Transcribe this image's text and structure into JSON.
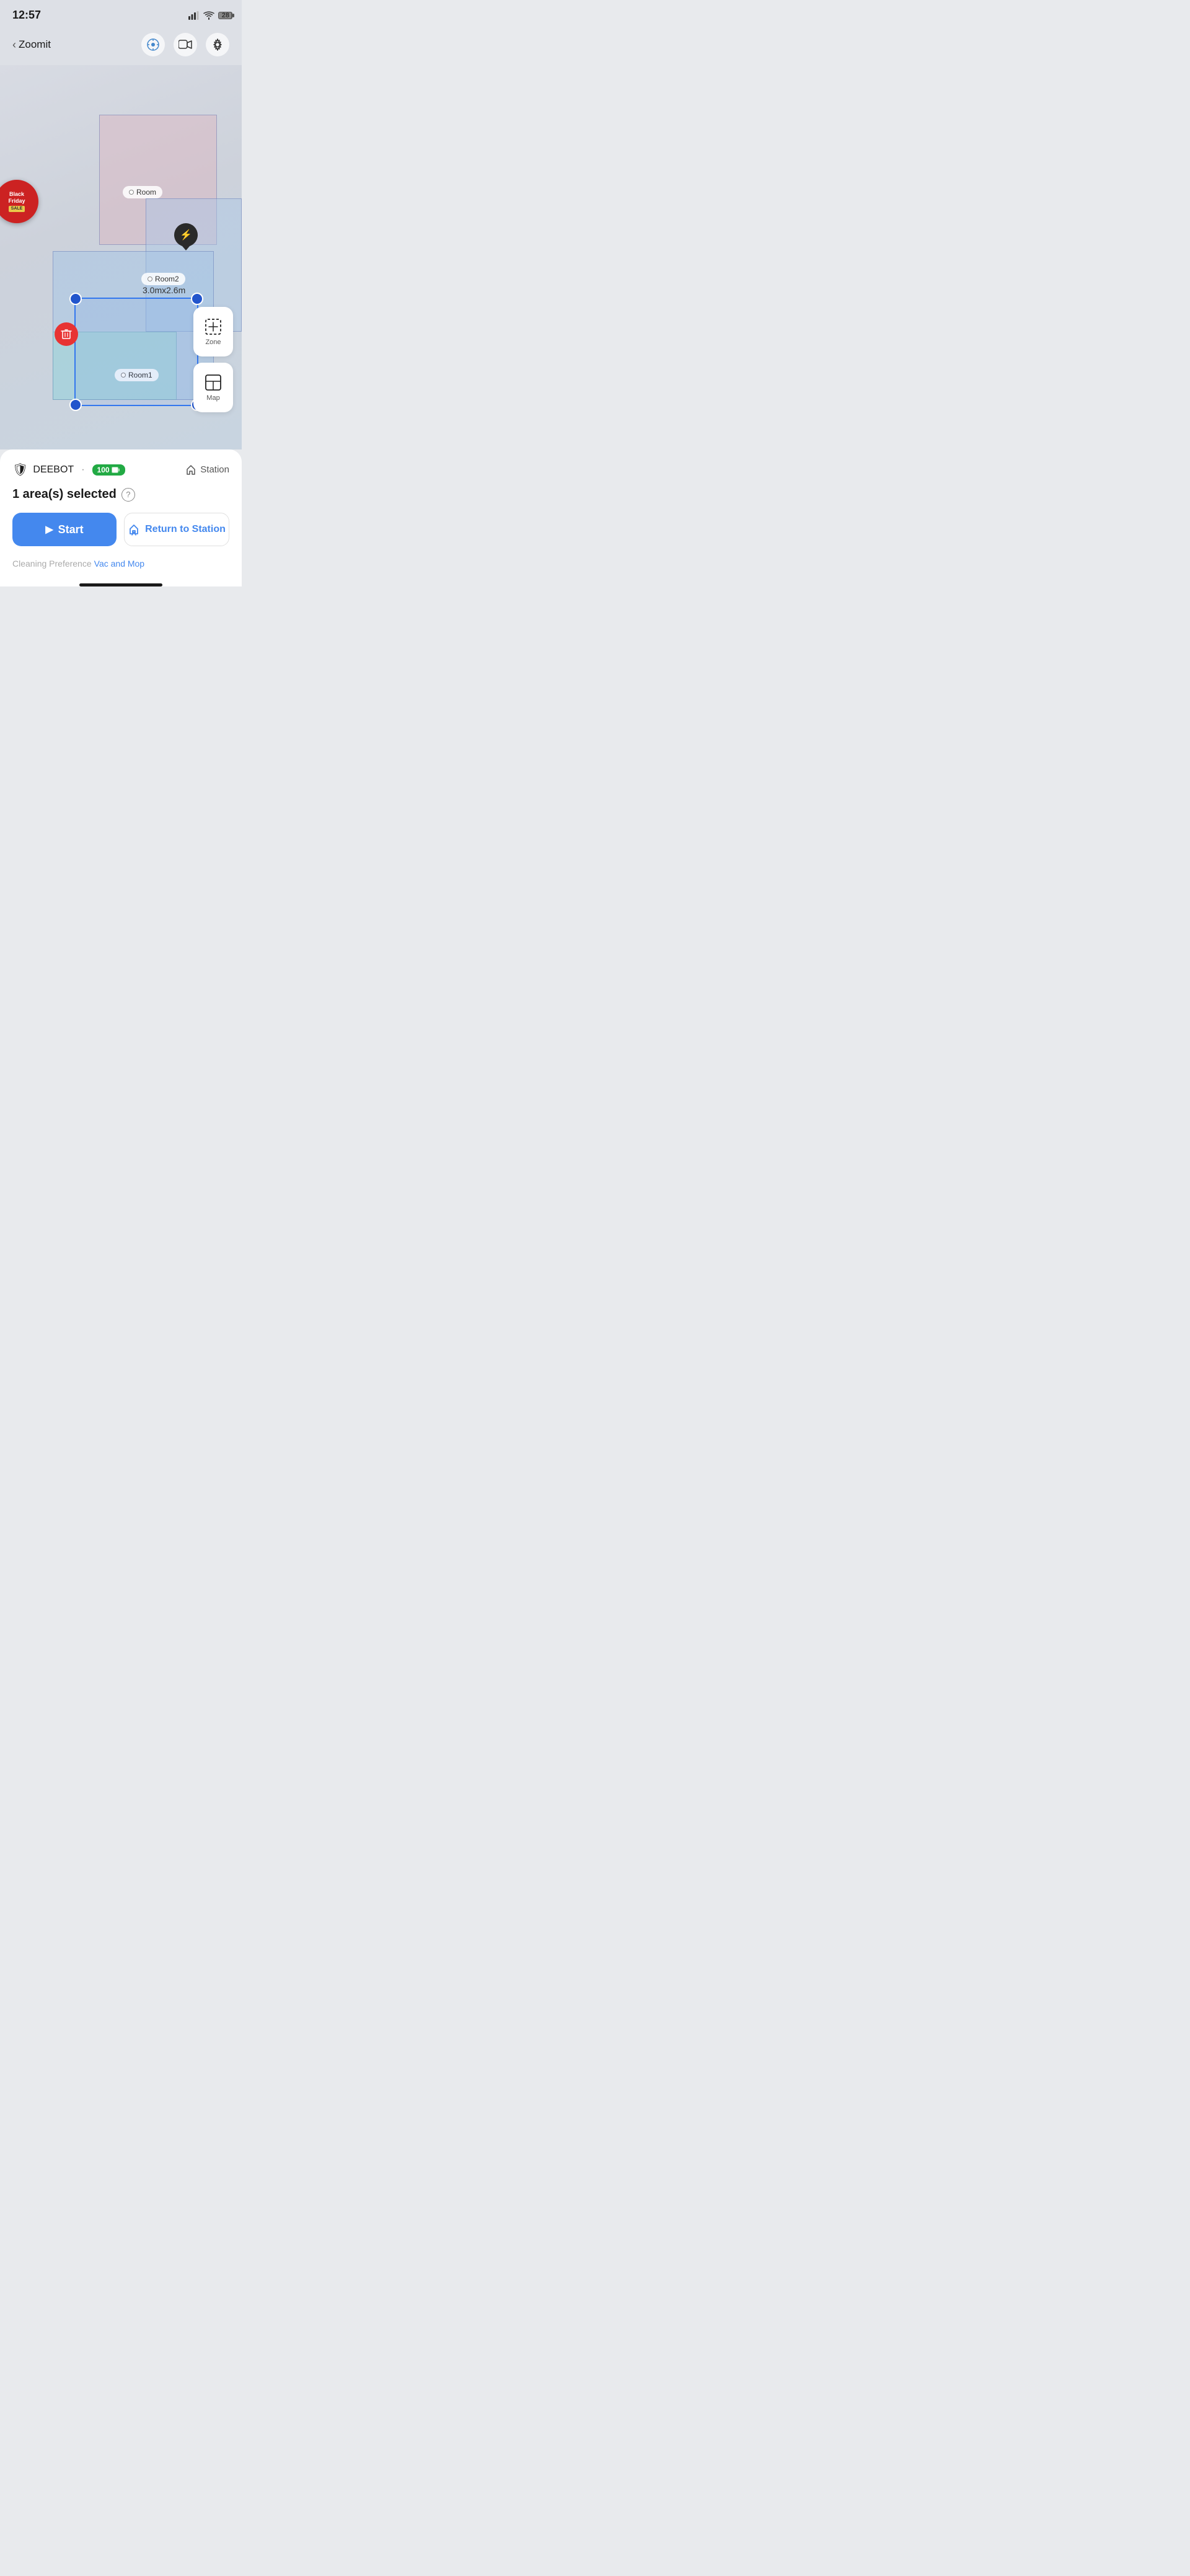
{
  "status_bar": {
    "time": "12:57",
    "battery_level": "28"
  },
  "nav": {
    "back_label": "Zoomit",
    "back_chevron": "‹"
  },
  "map": {
    "rooms": [
      {
        "id": "room",
        "label": "Room"
      },
      {
        "id": "room2",
        "label": "Room2"
      },
      {
        "id": "room1",
        "label": "Room1"
      }
    ],
    "zone_dimensions": "3.0mx2.6m",
    "charging_icon": "⚡"
  },
  "tools": [
    {
      "id": "zone",
      "icon": "⊞",
      "label": "Zone"
    },
    {
      "id": "map",
      "icon": "⊟",
      "label": "Map"
    }
  ],
  "bottom_panel": {
    "robot_name": "DEEBOT",
    "dot": "·",
    "battery": "100",
    "station_label": "Station",
    "area_selected": "1 area(s) selected",
    "start_label": "Start",
    "return_label": "Return to Station",
    "cleaning_pref_prefix": "Cleaning Preference",
    "cleaning_pref_link": "Vac and Mop"
  },
  "black_friday": {
    "line1": "Black",
    "line2": "Friday",
    "sale": "SALE"
  }
}
